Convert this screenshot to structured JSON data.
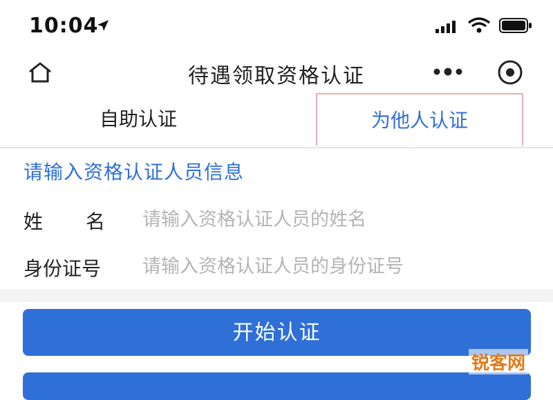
{
  "status_bar": {
    "time": "10:04"
  },
  "nav": {
    "title": "待遇领取资格认证"
  },
  "tabs": [
    {
      "label": "自助认证",
      "active": false
    },
    {
      "label": "为他人认证",
      "active": true
    }
  ],
  "form": {
    "header": "请输入资格认证人员信息",
    "fields": [
      {
        "label": "姓名",
        "value": "",
        "placeholder": "请输入资格认证人员的姓名"
      },
      {
        "label": "身份证号",
        "value": "",
        "placeholder": "请输入资格认证人员的身份证号"
      }
    ]
  },
  "buttons": {
    "start_label": "开始认证"
  },
  "watermark": "锐客网",
  "colors": {
    "accent": "#2f6fd8",
    "tab_border": "#e2b2b2",
    "background": "#ffffff"
  },
  "icons": {
    "location": "location-arrow-icon",
    "signal": "signal-icon",
    "wifi": "wifi-icon",
    "battery": "battery-icon",
    "home": "home-icon",
    "more": "more-icon",
    "record": "record-icon"
  }
}
